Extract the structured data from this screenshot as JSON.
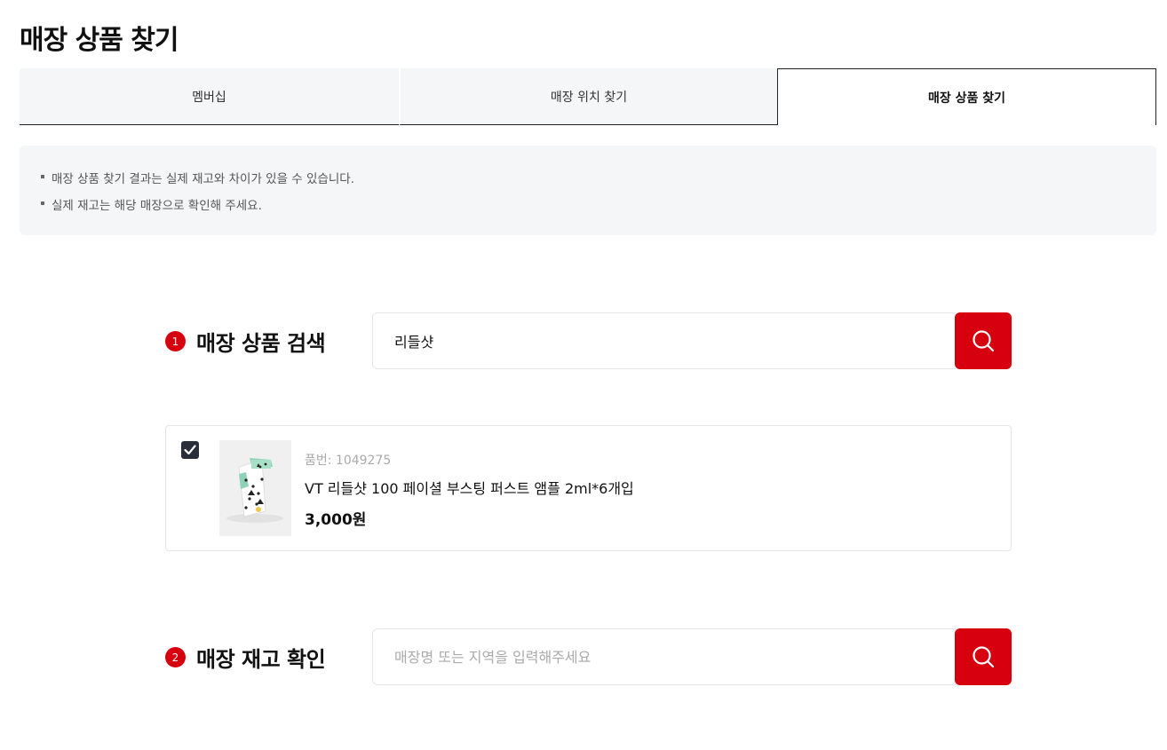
{
  "page": {
    "title": "매장 상품 찾기"
  },
  "tabs": [
    {
      "label": "멤버십"
    },
    {
      "label": "매장 위치 찾기"
    },
    {
      "label": "매장 상품 찾기"
    }
  ],
  "notice": {
    "items": [
      "매장 상품 찾기 결과는 실제 재고와 차이가 있을 수 있습니다.",
      "실제 재고는 해당 매장으로 확인해 주세요."
    ]
  },
  "product_search": {
    "step": "1",
    "label": "매장 상품 검색",
    "value": "리들샷",
    "icon": "search-icon"
  },
  "product": {
    "checked": true,
    "code": "품번: 1049275",
    "name": "VT 리들샷 100 페이셜 부스팅 퍼스트 앰플 2ml*6개입",
    "price": "3,000원"
  },
  "stock_search": {
    "step": "2",
    "label": "매장 재고 확인",
    "value": "",
    "placeholder": "매장명 또는 지역을 입력해주세요",
    "icon": "search-icon"
  },
  "colors": {
    "accent": "#d7000f",
    "checkbox": "#2a2e3a",
    "notice_bg": "#f5f6f7"
  }
}
